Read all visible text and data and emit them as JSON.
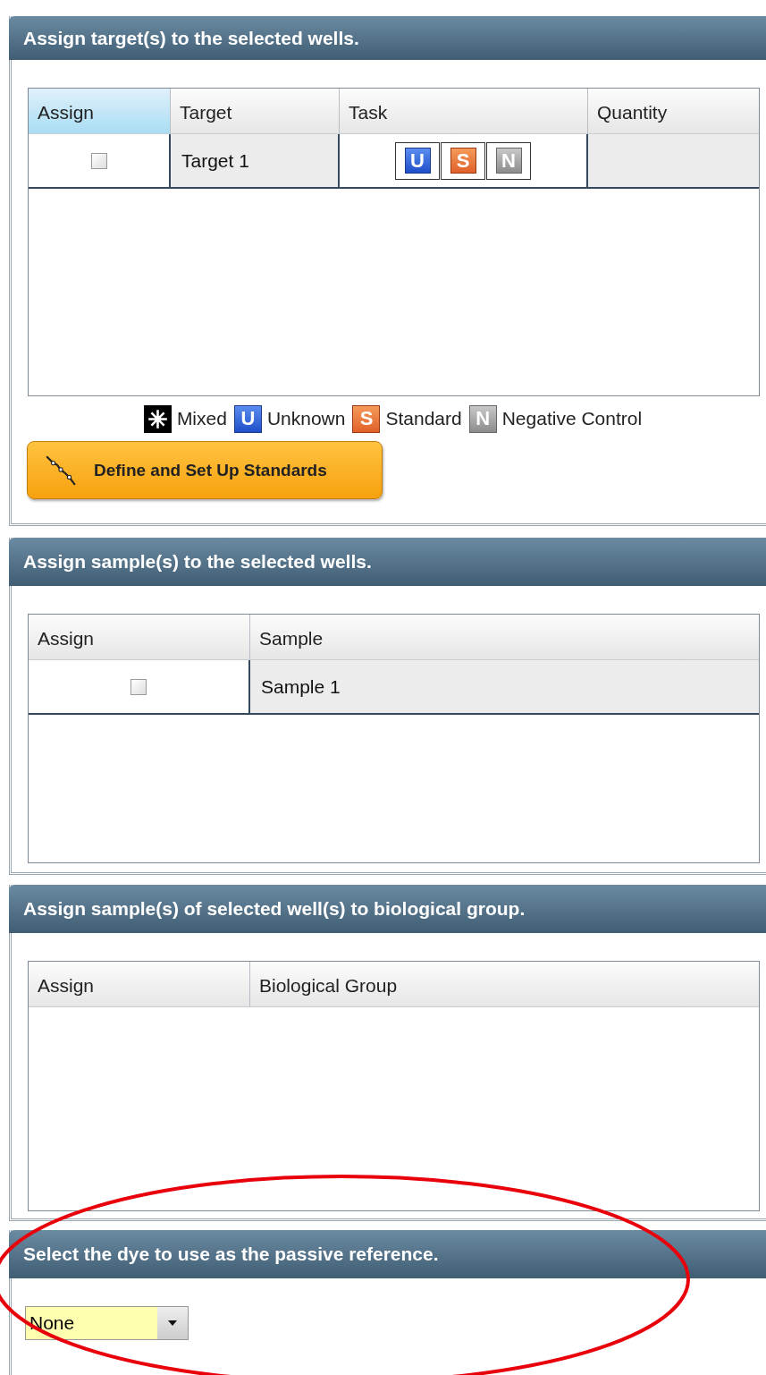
{
  "target_panel": {
    "title": "Assign target(s) to the selected wells.",
    "columns": [
      {
        "label": "Assign",
        "selected": true
      },
      {
        "label": "Target",
        "selected": false
      },
      {
        "label": "Task",
        "selected": false
      },
      {
        "label": "Quantity",
        "selected": false
      }
    ],
    "rows": [
      {
        "checked": false,
        "target": "Target 1",
        "tasks": [
          {
            "kind": "unknown",
            "letter": "U"
          },
          {
            "kind": "standard",
            "letter": "S"
          },
          {
            "kind": "negative",
            "letter": "N"
          }
        ]
      }
    ],
    "legend": [
      {
        "kind": "mixed",
        "label": "Mixed"
      },
      {
        "kind": "unknown",
        "letter": "U",
        "label": "Unknown"
      },
      {
        "kind": "standard",
        "letter": "S",
        "label": "Standard"
      },
      {
        "kind": "negative",
        "letter": "N",
        "label": "Negative Control"
      }
    ],
    "button": "Define and Set Up Standards"
  },
  "sample_panel": {
    "title": "Assign sample(s) to the selected wells.",
    "columns": [
      {
        "label": "Assign"
      },
      {
        "label": "Sample"
      }
    ],
    "rows": [
      {
        "checked": false,
        "sample": "Sample 1"
      }
    ]
  },
  "group_panel": {
    "title": "Assign sample(s) of selected well(s) to biological group.",
    "columns": [
      {
        "label": "Assign"
      },
      {
        "label": "Biological Group"
      }
    ]
  },
  "dye_panel": {
    "title": "Select the dye to use as the passive reference.",
    "dropdown": {
      "value": "None"
    }
  }
}
